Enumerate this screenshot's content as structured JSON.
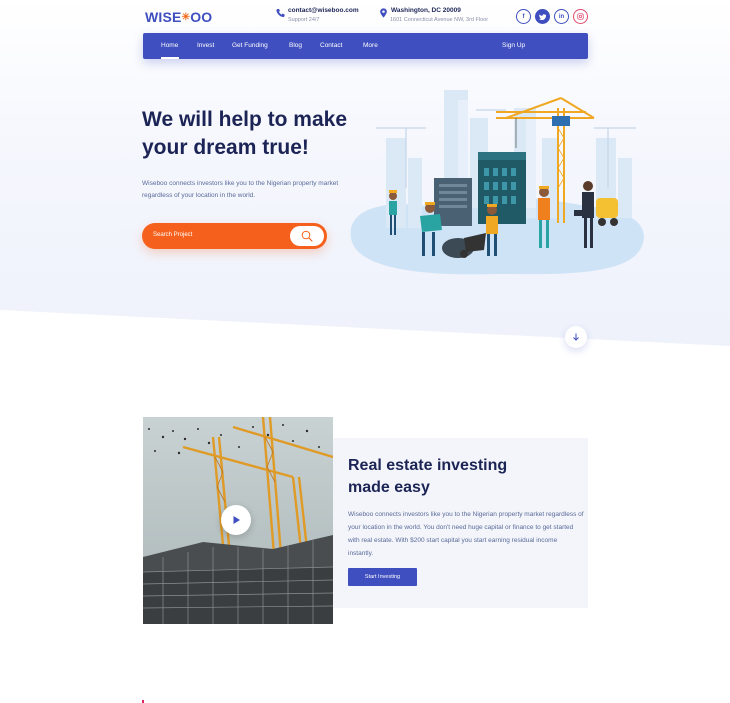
{
  "brand": {
    "logo_main": "WISE",
    "logo_tail": "OO",
    "primary": "#3f4fbf",
    "accent": "#f5611c"
  },
  "contact": {
    "email": "contact@wiseboo.com",
    "support": "Support 24/7",
    "icon": "phone-icon"
  },
  "address": {
    "city": "Washington, DC 20009",
    "street": "1601 Connecticut Avenue NW, 3rd Floor",
    "icon": "location-pin-icon"
  },
  "socials": [
    {
      "icon": "facebook-icon",
      "glyph": "f"
    },
    {
      "icon": "twitter-icon",
      "glyph": "t"
    },
    {
      "icon": "linkedin-icon",
      "glyph": "in"
    },
    {
      "icon": "instagram-icon",
      "glyph": "◎"
    }
  ],
  "nav": {
    "items": [
      "Home",
      "Invest",
      "Get Funding",
      "Blog",
      "Contact",
      "More"
    ],
    "active": "Home",
    "signup": "Sign Up"
  },
  "hero": {
    "title_line1": "We will help to make",
    "title_line2": "your dream true!",
    "description": "Wiseboo connects investors like you to the Nigerian property market regardless of your location in the world.",
    "search_placeholder": "Search Project"
  },
  "feature": {
    "title": "Real estate investing made easy",
    "text": "Wiseboo connects investors like you to the Nigerian property market regardless of your location in the world. You don't need huge capital or finance to get started with real estate. With $200 start capital you start earning residual income instantly.",
    "button": "Start Investing"
  }
}
